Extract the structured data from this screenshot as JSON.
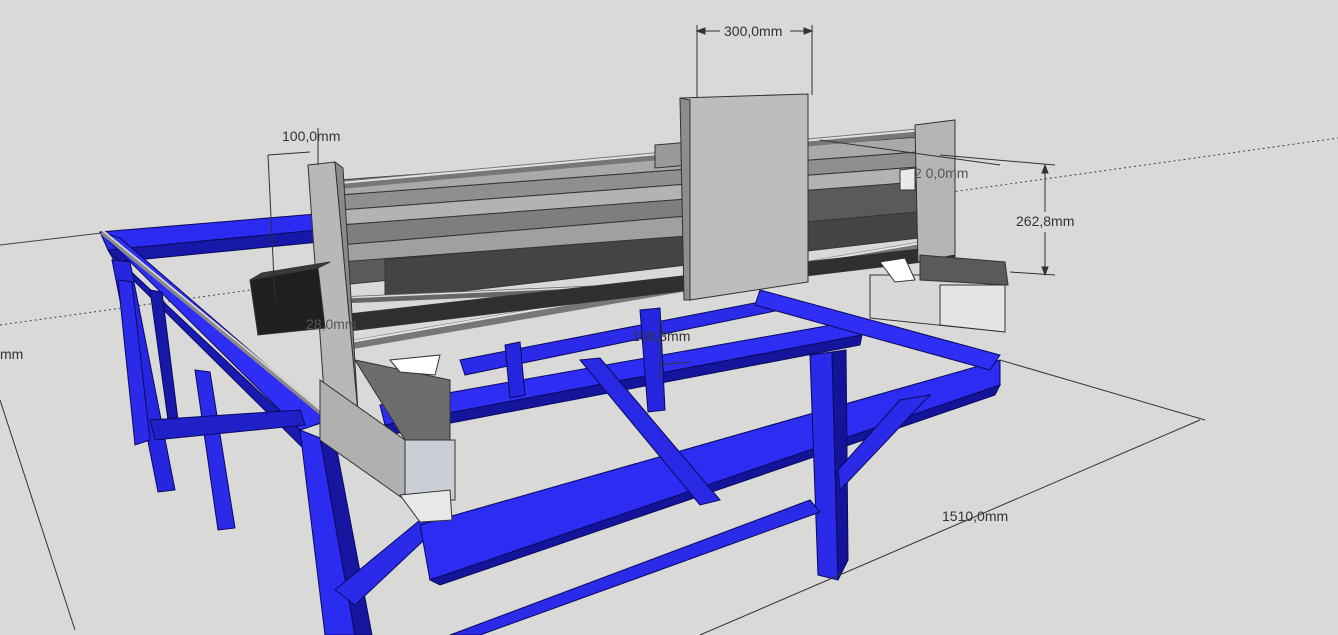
{
  "colors": {
    "background": "#d9d9d7",
    "frame_blue": "#2a2af0",
    "frame_blue_dark": "#1414a8",
    "aluminum": "#b5b5b5",
    "dimension_line": "#333333"
  },
  "dimensions": {
    "width_300": "300,0mm",
    "width_100": "100,0mm",
    "height_262": "262,8mm",
    "length_1510": "1510,0mm",
    "side_partial": "mm",
    "offset_28": "28,0mm",
    "offset_108": "108,3mm",
    "hidden_label": "2 0,0mm"
  }
}
